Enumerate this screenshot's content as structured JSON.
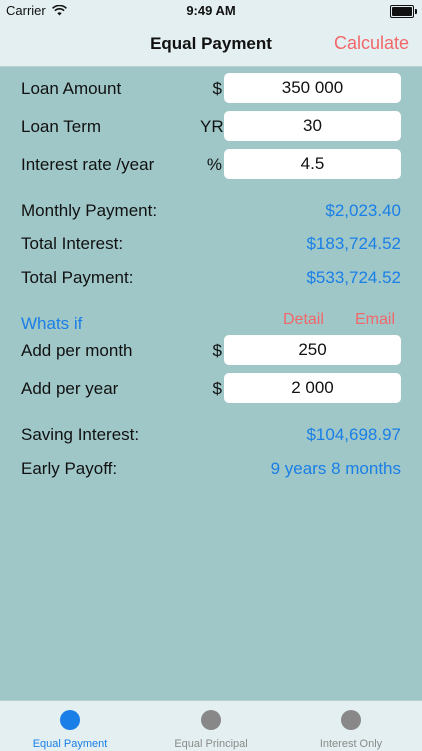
{
  "status_bar": {
    "carrier": "Carrier",
    "time": "9:49 AM"
  },
  "nav": {
    "title": "Equal Payment",
    "action": "Calculate"
  },
  "loan": {
    "amount_label": "Loan Amount",
    "amount_unit": "$",
    "amount_value": "350 000",
    "term_label": "Loan Term",
    "term_unit": "YR",
    "term_value": "30",
    "rate_label": "Interest rate /year",
    "rate_unit": "%",
    "rate_value": "4.5"
  },
  "results": {
    "monthly_label": "Monthly Payment:",
    "monthly_value": "$2,023.40",
    "interest_label": "Total Interest:",
    "interest_value": "$183,724.52",
    "payment_label": "Total Payment:",
    "payment_value": "$533,724.52"
  },
  "whatif": {
    "title": "Whats if",
    "detail": "Detail",
    "email": "Email",
    "month_label": "Add per month",
    "month_unit": "$",
    "month_value": "250",
    "year_label": "Add per year",
    "year_unit": "$",
    "year_value": "2 000",
    "saving_label": "Saving Interest:",
    "saving_value": "$104,698.97",
    "payoff_label": "Early Payoff:",
    "payoff_value": "9 years 8 months"
  },
  "tabs": [
    {
      "label": "Equal Payment",
      "active": true
    },
    {
      "label": "Equal Principal",
      "active": false
    },
    {
      "label": "Interest Only",
      "active": false
    }
  ],
  "colors": {
    "background": "#9fc7c8",
    "accent_blue": "#1a7fe6",
    "accent_red": "#f2676a",
    "bar": "#e3eff0"
  }
}
